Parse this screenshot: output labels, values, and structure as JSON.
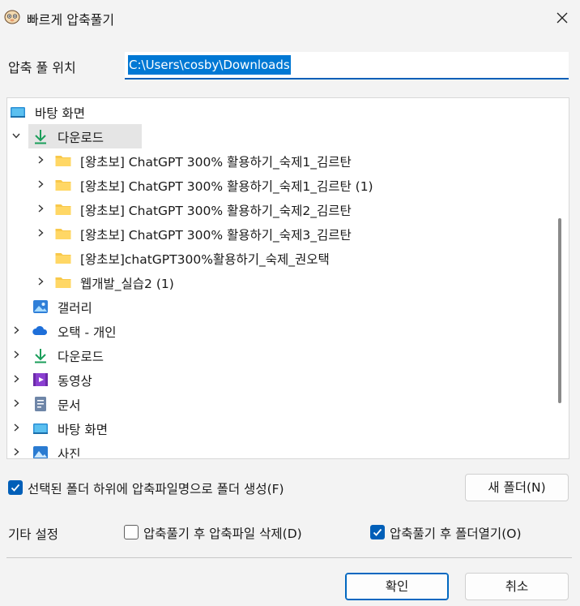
{
  "window": {
    "title": "빠르게 압축풀기",
    "close_icon": "close-icon"
  },
  "location": {
    "label": "압축 풀 위치",
    "value": "C:\\Users\\cosby\\Downloads"
  },
  "tree": [
    {
      "label": "바탕 화면",
      "icon": "desktop-icon",
      "chevron": "none"
    },
    {
      "label": "다운로드",
      "icon": "download-icon",
      "chevron": "expanded"
    },
    {
      "label": "[왕초보] ChatGPT 300% 활용하기_숙제1_김르탄",
      "icon": "folder-icon",
      "chevron": "collapsed"
    },
    {
      "label": "[왕초보] ChatGPT 300% 활용하기_숙제1_김르탄 (1)",
      "icon": "folder-icon",
      "chevron": "collapsed"
    },
    {
      "label": "[왕초보] ChatGPT 300% 활용하기_숙제2_김르탄",
      "icon": "folder-icon",
      "chevron": "collapsed"
    },
    {
      "label": "[왕초보] ChatGPT 300% 활용하기_숙제3_김르탄",
      "icon": "folder-icon",
      "chevron": "collapsed"
    },
    {
      "label": "[왕초보]chatGPT300%활용하기_숙제_권오택",
      "icon": "folder-icon",
      "chevron": "none"
    },
    {
      "label": "웹개발_실습2 (1)",
      "icon": "folder-icon",
      "chevron": "collapsed"
    },
    {
      "label": "갤러리",
      "icon": "gallery-icon",
      "chevron": "none"
    },
    {
      "label": "오택 - 개인",
      "icon": "onedrive-cloud-icon",
      "chevron": "collapsed"
    },
    {
      "label": "다운로드",
      "icon": "download-icon",
      "chevron": "collapsed"
    },
    {
      "label": "동영상",
      "icon": "video-icon",
      "chevron": "collapsed"
    },
    {
      "label": "문서",
      "icon": "document-icon",
      "chevron": "collapsed"
    },
    {
      "label": "바탕 화면",
      "icon": "desktop-icon",
      "chevron": "collapsed"
    },
    {
      "label": "사진",
      "icon": "pictures-icon",
      "chevron": "collapsed"
    }
  ],
  "options": {
    "create_folder": {
      "label": "선택된 폴더 하위에 압축파일명으로 폴더 생성(F)",
      "checked": true
    },
    "new_folder_button": "새 폴더(N)",
    "other_settings_label": "기타 설정",
    "delete_after": {
      "label": "압축풀기 후 압축파일 삭제(D)",
      "checked": false
    },
    "open_after": {
      "label": "압축풀기 후 폴더열기(O)",
      "checked": true
    }
  },
  "buttons": {
    "ok": "확인",
    "cancel": "취소"
  },
  "colors": {
    "accent": "#005fb8",
    "selection": "#0078d4",
    "folder": "#f8c84a",
    "download_green": "#1a9e5a"
  }
}
